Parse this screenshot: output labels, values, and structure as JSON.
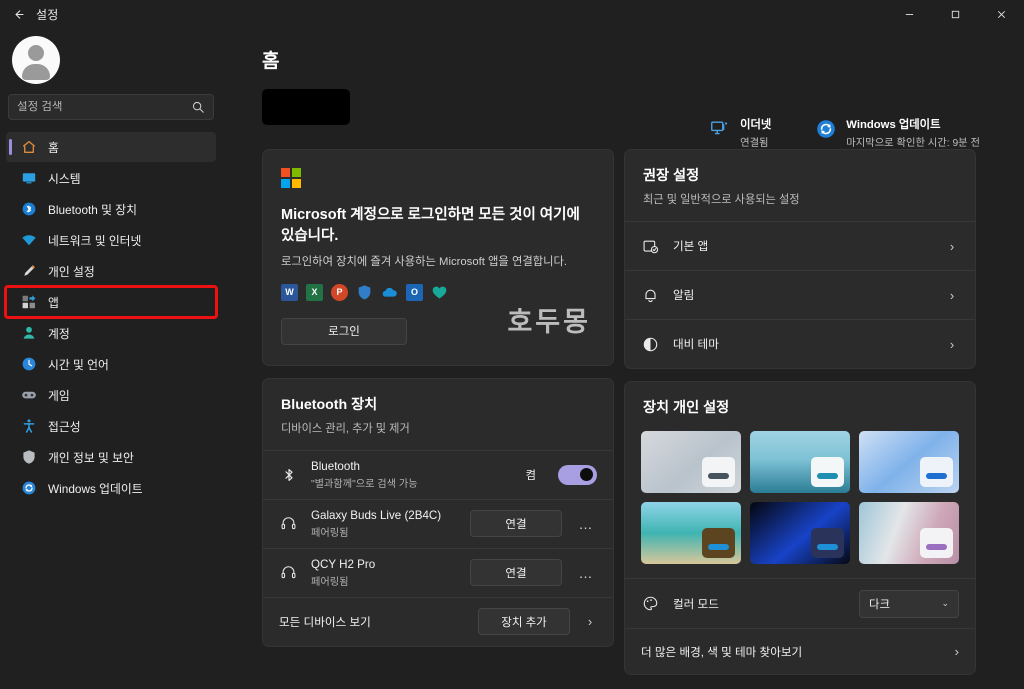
{
  "window": {
    "title": "설정",
    "back_icon": "back-arrow-icon",
    "controls": {
      "minimize": "minimize-icon",
      "maximize": "maximize-icon",
      "close": "close-icon"
    }
  },
  "sidebar": {
    "avatar": "user-avatar",
    "search": {
      "placeholder": "설정 검색",
      "value": "",
      "icon": "search-icon"
    },
    "items": [
      {
        "label": "홈",
        "icon": "home-icon",
        "selected": true,
        "highlighted": false
      },
      {
        "label": "시스템",
        "icon": "system-icon",
        "selected": false,
        "highlighted": false
      },
      {
        "label": "Bluetooth 및 장치",
        "icon": "bluetooth-icon",
        "selected": false,
        "highlighted": false
      },
      {
        "label": "네트워크 및 인터넷",
        "icon": "network-icon",
        "selected": false,
        "highlighted": false
      },
      {
        "label": "개인 설정",
        "icon": "personalization-icon",
        "selected": false,
        "highlighted": false
      },
      {
        "label": "앱",
        "icon": "apps-icon",
        "selected": false,
        "highlighted": true
      },
      {
        "label": "계정",
        "icon": "accounts-icon",
        "selected": false,
        "highlighted": false
      },
      {
        "label": "시간 및 언어",
        "icon": "time-language-icon",
        "selected": false,
        "highlighted": false
      },
      {
        "label": "게임",
        "icon": "gaming-icon",
        "selected": false,
        "highlighted": false
      },
      {
        "label": "접근성",
        "icon": "accessibility-icon",
        "selected": false,
        "highlighted": false
      },
      {
        "label": "개인 정보 및 보안",
        "icon": "privacy-security-icon",
        "selected": false,
        "highlighted": false
      },
      {
        "label": "Windows 업데이트",
        "icon": "windows-update-icon",
        "selected": false,
        "highlighted": false
      }
    ]
  },
  "header": {
    "page_title": "홈",
    "redacted_block": "",
    "status": [
      {
        "icon": "ethernet-icon",
        "title": "이더넷",
        "sub": "연결됨"
      },
      {
        "icon": "windows-update-icon",
        "title": "Windows 업데이트",
        "sub": "마지막으로 확인한 시간: 9분 전"
      }
    ]
  },
  "account_card": {
    "logo": "microsoft-logo",
    "heading": "Microsoft 계정으로 로그인하면 모든 것이 여기에 있습니다.",
    "subtext": "로그인하여 장치에 즐겨 사용하는 Microsoft 앱을 연결합니다.",
    "apps": [
      {
        "name": "word-icon",
        "letter": "W",
        "color": "#2b579a"
      },
      {
        "name": "excel-icon",
        "letter": "X",
        "color": "#217346"
      },
      {
        "name": "powerpoint-icon",
        "letter": "P",
        "color": "#d24726"
      },
      {
        "name": "defender-icon",
        "letter": "",
        "color": "#2f7ec7"
      },
      {
        "name": "onedrive-icon",
        "letter": "",
        "color": "#1a8fd8"
      },
      {
        "name": "outlook-icon",
        "letter": "O",
        "color": "#1b66b5"
      },
      {
        "name": "health-icon",
        "letter": "",
        "color": "#17a99a"
      }
    ],
    "login_button": "로그인",
    "watermark": "호두몽"
  },
  "bluetooth_card": {
    "title": "Bluetooth 장치",
    "subtitle": "디바이스 관리, 추가 및 제거",
    "toggle_row": {
      "icon": "bluetooth-icon",
      "title": "Bluetooth",
      "sub": "\"별과함께\"으로 검색 가능",
      "toggle_label": "켬",
      "toggle_on": true
    },
    "devices": [
      {
        "icon": "headphones-icon",
        "name": "Galaxy Buds Live (2B4C)",
        "status": "페어링됨",
        "action": "연결",
        "more": "…"
      },
      {
        "icon": "headphones-icon",
        "name": "QCY H2 Pro",
        "status": "페어링됨",
        "action": "연결",
        "more": "…"
      }
    ],
    "footer": {
      "label": "모든 디바이스 보기",
      "action": "장치 추가",
      "chevron": "chevron-right-icon"
    }
  },
  "recommended_card": {
    "title": "권장 설정",
    "subtitle": "최근 및 일반적으로 사용되는 설정",
    "items": [
      {
        "icon": "default-apps-icon",
        "label": "기본 앱"
      },
      {
        "icon": "bell-icon",
        "label": "알림"
      },
      {
        "icon": "contrast-theme-icon",
        "label": "대비 테마"
      }
    ]
  },
  "personalization_card": {
    "title": "장치 개인 설정",
    "themes": [
      {
        "name": "theme-light-bloom",
        "bg": "linear-gradient(140deg,#d6d9dd 0%,#b9c3cc 55%,#cfd5da 100%)",
        "mini_bg": "#f2f4f6",
        "bar": "#46535c"
      },
      {
        "name": "theme-lake-sunrise",
        "bg": "linear-gradient(180deg,#9fd4e3 0%,#7fc2d6 45%,#2b7d94 100%)",
        "mini_bg": "#f4f7f8",
        "bar": "#1e8fb0"
      },
      {
        "name": "theme-blue-bloom-light",
        "bg": "linear-gradient(140deg,#cfe0f5 0%,#7fb2ea 50%,#bcd4f0 100%)",
        "mini_bg": "#eef3fa",
        "bar": "#1f6fd0"
      },
      {
        "name": "theme-tropical-beach",
        "bg": "linear-gradient(180deg,#8fd4e8 0%,#3fb4b2 50%,#d8c79a 100%)",
        "mini_bg": "#5c4420",
        "bar": "#1f8fd8"
      },
      {
        "name": "theme-blue-bloom-dark",
        "bg": "linear-gradient(140deg,#05060d 0%,#1843c8 55%,#060913 100%)",
        "mini_bg": "#2a3359",
        "bar": "#1f8fd8"
      },
      {
        "name": "theme-nature-mix",
        "bg": "linear-gradient(110deg,#9fc6d8 0%,#e3e6e8 38%,#cfa8b8 70%,#b88fa6 100%)",
        "mini_bg": "#f3f2f5",
        "bar": "#9a6fc0"
      }
    ],
    "color_mode": {
      "icon": "palette-icon",
      "label": "컬러 모드",
      "value": "다크",
      "chevron": "chevron-down-icon"
    },
    "more": {
      "label": "더 많은 배경, 색 및 테마 찾아보기",
      "chevron": "chevron-right-icon"
    }
  },
  "colors": {
    "accent": "#9a8fe0",
    "toggle_on": "#a89fe3",
    "highlight_box": "#ee1111",
    "window_bg": "#202020",
    "card_bg": "#2b2b2b"
  }
}
